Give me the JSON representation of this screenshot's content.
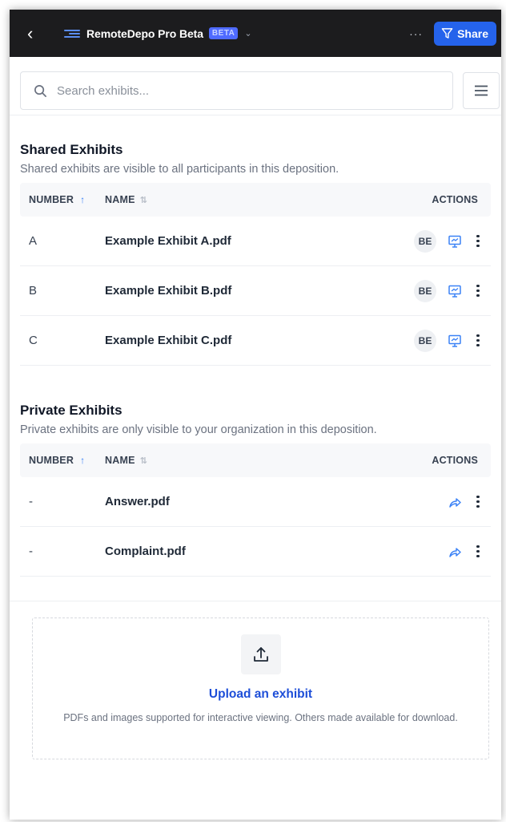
{
  "header": {
    "back_icon": "chevron-left-icon",
    "app_title": "RemoteDepo Pro Beta",
    "beta_badge": "BETA",
    "more_label": "···",
    "share_label": "Share",
    "share_icon": "filter-funnel-icon",
    "colors": {
      "bar": "#1c1c1e",
      "share": "#2563eb",
      "beta": "#4f6bff"
    }
  },
  "search": {
    "placeholder": "Search exhibits...",
    "value": ""
  },
  "shared": {
    "title": "Shared Exhibits",
    "description": "Shared exhibits are visible to all participants in this deposition.",
    "columns": {
      "number": "NUMBER",
      "name": "NAME",
      "actions": "ACTIONS"
    },
    "rows": [
      {
        "number": "A",
        "name": "Example Exhibit A.pdf",
        "badge": "BE"
      },
      {
        "number": "B",
        "name": "Example Exhibit B.pdf",
        "badge": "BE"
      },
      {
        "number": "C",
        "name": "Example Exhibit C.pdf",
        "badge": "BE"
      }
    ]
  },
  "private": {
    "title": "Private Exhibits",
    "description": "Private exhibits are only visible to your organization in this deposition.",
    "columns": {
      "number": "NUMBER",
      "name": "NAME",
      "actions": "ACTIONS"
    },
    "rows": [
      {
        "number": "-",
        "name": "Answer.pdf"
      },
      {
        "number": "-",
        "name": "Complaint.pdf"
      }
    ]
  },
  "upload": {
    "title": "Upload an exhibit",
    "description": "PDFs and images supported for interactive viewing. Others made available for download."
  }
}
